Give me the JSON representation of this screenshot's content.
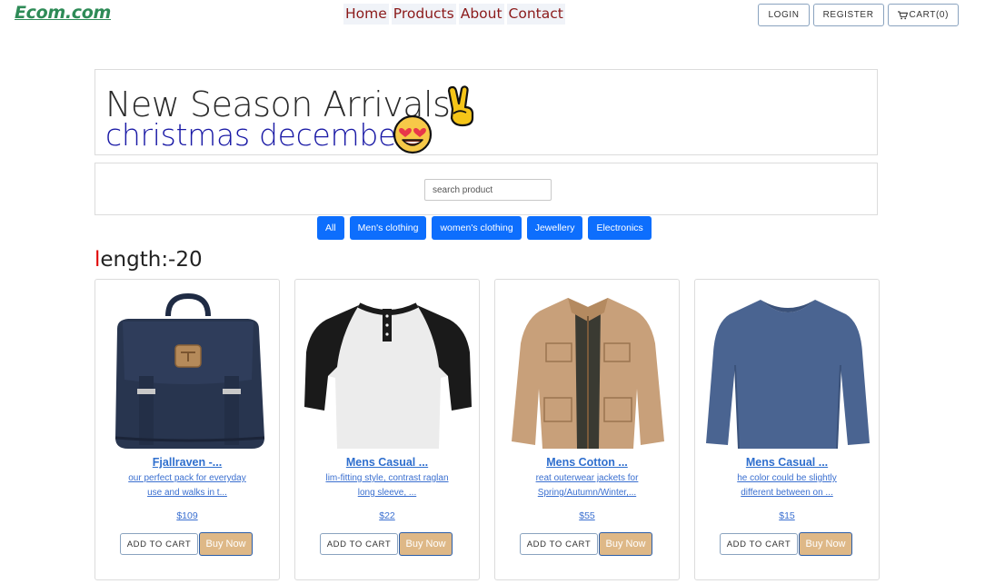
{
  "header": {
    "logo": "Ecom.com",
    "nav": [
      "Home",
      "Products",
      "About",
      "Contact"
    ],
    "login": "LOGIN",
    "register": "REGISTER",
    "cart": "CART(0)"
  },
  "hero": {
    "title": "New Season Arrivals",
    "subtitle": "christmas december",
    "title_emoji": "victory-hand-icon",
    "subtitle_emoji": "heart-eyes-face-icon"
  },
  "search": {
    "placeholder": "search product"
  },
  "categories": [
    "All",
    "Men's clothing",
    "women's clothing",
    "Jewellery",
    "Electronics"
  ],
  "length_label": {
    "first": "l",
    "rest": "ength:-20"
  },
  "products": [
    {
      "title": "Fjallraven -...",
      "desc_line1": "our perfect pack for everyday",
      "desc_line2": "use and walks in t...",
      "price": "$109",
      "add": "ADD TO CART",
      "buy": "Buy Now",
      "image": "backpack-image"
    },
    {
      "title": "Mens Casual ...",
      "desc_line1": "lim-fitting style, contrast raglan",
      "desc_line2": "long sleeve, ...",
      "price": "$22",
      "add": "ADD TO CART",
      "buy": "Buy Now",
      "image": "raglan-tshirt-image"
    },
    {
      "title": "Mens Cotton ...",
      "desc_line1": "reat outerwear jackets for",
      "desc_line2": "Spring/Autumn/Winter,...",
      "price": "$55",
      "add": "ADD TO CART",
      "buy": "Buy Now",
      "image": "cotton-jacket-image"
    },
    {
      "title": "Mens Casual ...",
      "desc_line1": "he color could be slightly",
      "desc_line2": "different between on ...",
      "price": "$15",
      "add": "ADD TO CART",
      "buy": "Buy Now",
      "image": "long-sleeve-shirt-image"
    }
  ],
  "colors": {
    "logo": "#2e8b57",
    "nav_text": "#8b1a1a",
    "category_button": "#0d6efd",
    "buy_button": "#deb887",
    "link": "#2f6fce",
    "subtitle": "#1a1aa6"
  }
}
